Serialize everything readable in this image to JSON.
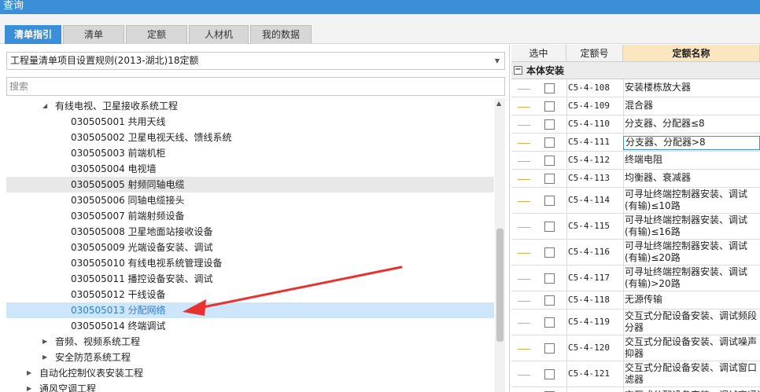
{
  "window": {
    "title": "查询"
  },
  "tabs": [
    {
      "label": "清单指引",
      "active": true
    },
    {
      "label": "清单",
      "active": false
    },
    {
      "label": "定额",
      "active": false
    },
    {
      "label": "人材机",
      "active": false
    },
    {
      "label": "我的数据",
      "active": false
    }
  ],
  "left": {
    "spec_select": "工程量清单项目设置规则(2013-湖北)18定额",
    "search_placeholder": "搜索",
    "tree": [
      {
        "text": "有线电视、卫星接收系统工程",
        "toggle": "expanded"
      },
      {
        "text": "030505001  共用天线"
      },
      {
        "text": "030505002  卫星电视天线、馈线系统"
      },
      {
        "text": "030505003  前端机柜"
      },
      {
        "text": "030505004  电视墙"
      },
      {
        "text": "030505005  射频同轴电缆",
        "state": "hover"
      },
      {
        "text": "030505006  同轴电缆接头"
      },
      {
        "text": "030505007  前端射频设备"
      },
      {
        "text": "030505008  卫星地面站接收设备"
      },
      {
        "text": "030505009  光端设备安装、调试"
      },
      {
        "text": "030505010  有线电视系统管理设备"
      },
      {
        "text": "030505011  播控设备安装、调试"
      },
      {
        "text": "030505012  干线设备"
      },
      {
        "text": "030505013  分配网络",
        "state": "selected"
      },
      {
        "text": "030505014  终端调试"
      },
      {
        "text": "音频、视频系统工程",
        "toggle": "collapsed"
      },
      {
        "text": "安全防范系统工程",
        "toggle": "collapsed"
      },
      {
        "text": "自动化控制仪表安装工程",
        "toggle": "collapsed"
      },
      {
        "text": "通风空调工程",
        "toggle": "collapsed"
      }
    ]
  },
  "right": {
    "columns": {
      "select": "选中",
      "code": "定额号",
      "name": "定额名称"
    },
    "group": {
      "toggle": "−",
      "label": "本体安装"
    },
    "rows": [
      {
        "code": "C5-4-108",
        "name": "安装楼栋放大器"
      },
      {
        "code": "C5-4-109",
        "name": "混合器"
      },
      {
        "code": "C5-4-110",
        "name": "分支器、分配器≤8"
      },
      {
        "code": "C5-4-111",
        "name": "分支器、分配器>8"
      },
      {
        "code": "C5-4-112",
        "name": "终端电阻"
      },
      {
        "code": "C5-4-113",
        "name": "均衡器、衰减器"
      },
      {
        "code": "C5-4-114",
        "name": "可寻址终端控制器安装、调试(有输)≤10路"
      },
      {
        "code": "C5-4-115",
        "name": "可寻址终端控制器安装、调试(有输)≤16路"
      },
      {
        "code": "C5-4-116",
        "name": "可寻址终端控制器安装、调试(有输)≤20路"
      },
      {
        "code": "C5-4-117",
        "name": "可寻址终端控制器安装、调试(有输)>20路"
      },
      {
        "code": "C5-4-118",
        "name": "无源传输"
      },
      {
        "code": "C5-4-119",
        "name": "交互式分配设备安装、调试频段分器"
      },
      {
        "code": "C5-4-120",
        "name": "交互式分配设备安装、调试噪声抑器"
      },
      {
        "code": "C5-4-121",
        "name": "交互式分配设备安装、调试窗口滤器"
      },
      {
        "code": "",
        "name": "交互式分配设备安装、调试高通滤"
      }
    ]
  },
  "colors": {
    "accent": "#3b8fd9",
    "selected_row_bg": "#cde6fb",
    "annotation_arrow": "#e8322f",
    "name_header_bg": "#fce6c0"
  }
}
